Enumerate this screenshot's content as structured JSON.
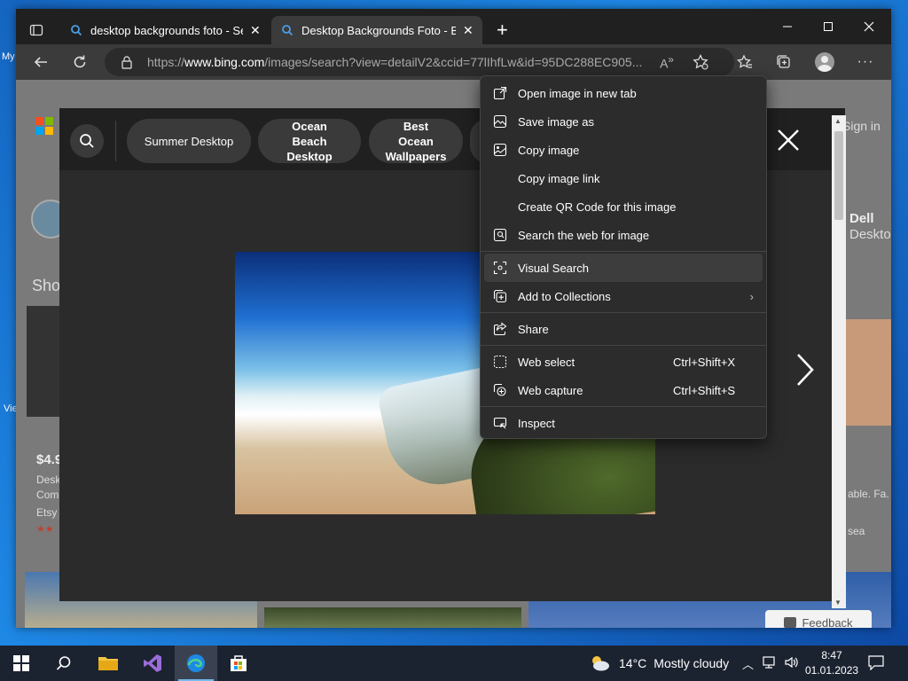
{
  "desktop": {
    "left_text_1": "My",
    "left_text_2": "Vie"
  },
  "browser": {
    "tabs": [
      {
        "title": "desktop backgrounds foto - Sear",
        "active": false
      },
      {
        "title": "Desktop Backgrounds Foto - Bing",
        "active": true
      }
    ],
    "new_tab_label": "+",
    "url_prefix": "https://",
    "url_domain": "www.bing.com",
    "url_path": "/images/search?view=detailV2&ccid=77lIhfLw&id=95DC288EC905..."
  },
  "page": {
    "sign_in": "Sign in",
    "shop_text": "Sho",
    "price_text": "$4.9",
    "desc_1": "Desk",
    "desc_2": "Com",
    "seller": "Etsy",
    "right_brand_1": "Dell",
    "right_brand_2": "Deskto",
    "right_desc": "able. Fa.",
    "right_seller": "sea",
    "feedback_label": "Feedback"
  },
  "viewer": {
    "chips": [
      {
        "label": "Summer Desktop",
        "bold": false
      },
      {
        "label": "Ocean Beach Desktop",
        "bold": true
      },
      {
        "label": "Best Ocean Wallpapers",
        "bold": true
      }
    ]
  },
  "context_menu": {
    "items": [
      {
        "label": "Open image in new tab",
        "icon": "open-in-new-tab-icon"
      },
      {
        "label": "Save image as",
        "icon": "save-image-icon"
      },
      {
        "label": "Copy image",
        "icon": "copy-image-icon"
      },
      {
        "label": "Copy image link",
        "icon": ""
      },
      {
        "label": "Create QR Code for this image",
        "icon": ""
      },
      {
        "label": "Search the web for image",
        "icon": "search-web-image-icon"
      },
      {
        "label": "Visual Search",
        "icon": "visual-search-icon"
      },
      {
        "label": "Add to Collections",
        "icon": "collections-icon"
      },
      {
        "label": "Share",
        "icon": "share-icon"
      },
      {
        "label": "Web select",
        "icon": "web-select-icon",
        "shortcut": "Ctrl+Shift+X"
      },
      {
        "label": "Web capture",
        "icon": "web-capture-icon",
        "shortcut": "Ctrl+Shift+S"
      },
      {
        "label": "Inspect",
        "icon": "inspect-icon"
      }
    ],
    "hovered": "Visual Search"
  },
  "taskbar": {
    "weather_temp": "14°C",
    "weather_desc": "Mostly cloudy",
    "time": "8:47",
    "date": "01.01.2023"
  },
  "colors": {
    "accent": "#76b9ed",
    "menu_bg": "#2c2c2c"
  }
}
